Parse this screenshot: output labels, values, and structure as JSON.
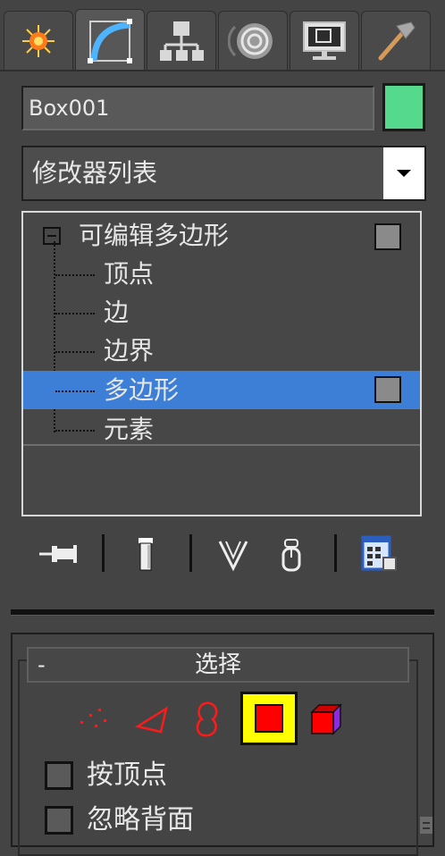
{
  "tabs": [
    {
      "name": "create",
      "icon": "sun-burst-icon"
    },
    {
      "name": "modify",
      "icon": "curve-modify-icon",
      "active": true
    },
    {
      "name": "hierarchy",
      "icon": "hierarchy-icon"
    },
    {
      "name": "motion",
      "icon": "motion-disc-icon"
    },
    {
      "name": "display",
      "icon": "display-monitor-icon"
    },
    {
      "name": "utilities",
      "icon": "hammer-icon"
    }
  ],
  "object": {
    "name": "Box001",
    "color": "#55d98c"
  },
  "modifier_list": {
    "selected": "修改器列表"
  },
  "stack": {
    "root": "可编辑多边形",
    "subobjects": [
      "顶点",
      "边",
      "边界",
      "多边形",
      "元素"
    ],
    "selected_index": 3
  },
  "stack_toolbar": [
    "pin-stack-icon",
    "show-end-result-icon",
    "make-unique-icon",
    "remove-modifier-icon",
    "configure-modifier-sets-icon"
  ],
  "selection_rollout": {
    "collapse_symbol": "-",
    "title": "选择",
    "levels": [
      "vertex-level-icon",
      "edge-level-icon",
      "border-level-icon",
      "polygon-level-icon",
      "element-level-icon"
    ],
    "active_level": 3,
    "options": [
      {
        "label": "按顶点",
        "checked": false
      },
      {
        "label": "忽略背面",
        "checked": false
      }
    ]
  },
  "colors": {
    "panel_bg": "#444444",
    "selection_blue": "#3d7fd6",
    "active_highlight": "#ffff00",
    "subobject_red": "#ff0000"
  }
}
